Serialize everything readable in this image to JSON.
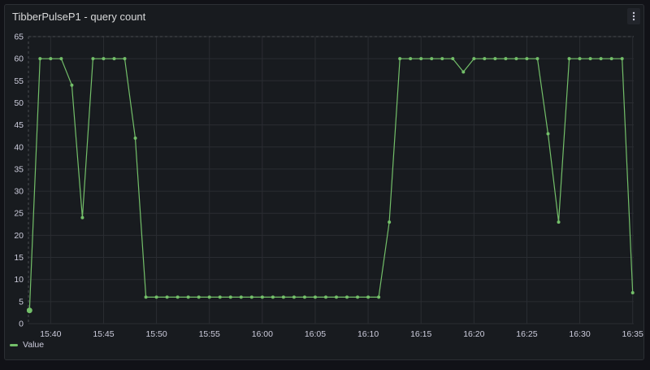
{
  "panel": {
    "title": "TibberPulseP1 - query count",
    "menu_icon": "kebab-menu-icon"
  },
  "colors": {
    "series": "#73bf69",
    "grid": "#2a2d32",
    "text": "#ccccdc",
    "background": "#181b1f"
  },
  "chart_data": {
    "type": "line",
    "title": "TibberPulseP1 - query count",
    "xlabel": "",
    "ylabel": "",
    "ylim": [
      0,
      65
    ],
    "y_ticks": [
      0,
      5,
      10,
      15,
      20,
      25,
      30,
      35,
      40,
      45,
      50,
      55,
      60,
      65
    ],
    "x_ticks": [
      "15:40",
      "15:45",
      "15:50",
      "15:55",
      "16:00",
      "16:05",
      "16:10",
      "16:15",
      "16:20",
      "16:25",
      "16:30",
      "16:35"
    ],
    "x_tick_minutes": [
      2,
      7,
      12,
      17,
      22,
      27,
      32,
      37,
      42,
      47,
      52,
      57
    ],
    "x_range_minutes": [
      -0.1,
      57.1
    ],
    "grid": true,
    "legend": "bottom-left",
    "series": [
      {
        "name": "Value",
        "color": "#73bf69",
        "x": [
          0,
          1,
          2,
          3,
          4,
          5,
          6,
          7,
          8,
          9,
          10,
          11,
          12,
          13,
          14,
          15,
          16,
          17,
          18,
          19,
          20,
          21,
          22,
          23,
          24,
          25,
          26,
          27,
          28,
          29,
          30,
          31,
          32,
          33,
          34,
          35,
          36,
          37,
          38,
          39,
          40,
          41,
          42,
          43,
          44,
          45,
          46,
          47,
          48,
          49,
          50,
          51,
          52,
          53,
          54,
          55,
          56,
          57
        ],
        "values": [
          3,
          60,
          60,
          60,
          54,
          24,
          60,
          60,
          60,
          60,
          42,
          6,
          6,
          6,
          6,
          6,
          6,
          6,
          6,
          6,
          6,
          6,
          6,
          6,
          6,
          6,
          6,
          6,
          6,
          6,
          6,
          6,
          6,
          6,
          23,
          60,
          60,
          60,
          60,
          60,
          60,
          57,
          60,
          60,
          60,
          60,
          60,
          60,
          60,
          43,
          23,
          60,
          60,
          60,
          60,
          60,
          60,
          7
        ]
      }
    ]
  }
}
